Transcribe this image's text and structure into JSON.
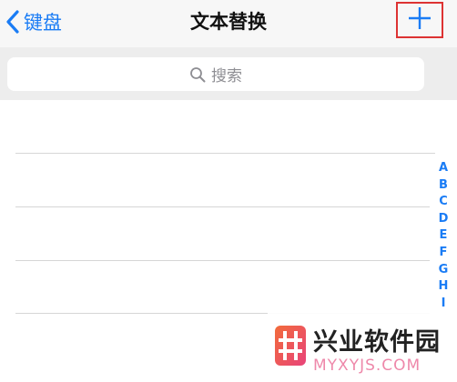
{
  "navbar": {
    "back_label": "键盘",
    "title": "文本替换",
    "add_icon": "plus-icon"
  },
  "search": {
    "placeholder": "搜索",
    "icon": "search-icon"
  },
  "list": {
    "rows": [
      "",
      "",
      "",
      ""
    ]
  },
  "index": [
    "A",
    "B",
    "C",
    "D",
    "E",
    "F",
    "G",
    "H",
    "I"
  ],
  "watermark": {
    "name": "兴业软件园",
    "url": "MYXYJS.COM"
  },
  "colors": {
    "accent": "#1a7cf5",
    "highlight_box": "#dd3333",
    "navbar_bg": "#f7f7f7",
    "search_bg": "#ededed"
  }
}
